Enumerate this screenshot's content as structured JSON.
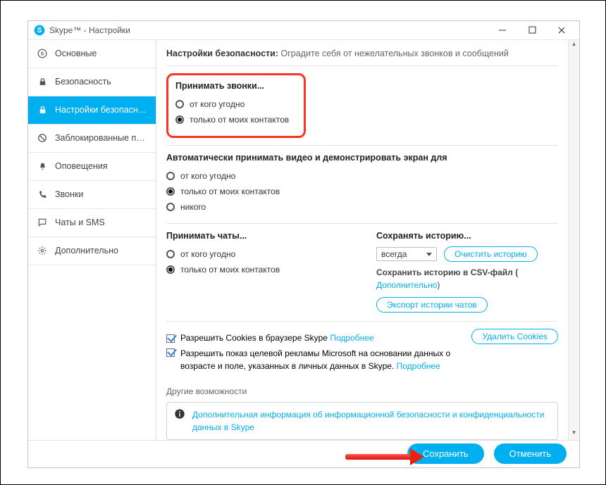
{
  "window": {
    "title": "Skype™ - Настройки"
  },
  "sidebar": {
    "items": [
      {
        "label": "Основные",
        "icon": "skype-icon"
      },
      {
        "label": "Безопасность",
        "icon": "lock-icon"
      },
      {
        "label": "Настройки безопасно...",
        "icon": "lock-icon"
      },
      {
        "label": "Заблокированные по...",
        "icon": "blocked-icon"
      },
      {
        "label": "Оповещения",
        "icon": "bell-icon"
      },
      {
        "label": "Звонки",
        "icon": "phone-icon"
      },
      {
        "label": "Чаты и SMS",
        "icon": "chat-icon"
      },
      {
        "label": "Дополнительно",
        "icon": "gear-icon"
      }
    ]
  },
  "header": {
    "bold": "Настройки безопасности:",
    "rest": "Оградите себя от нежелательных звонков и сообщений"
  },
  "calls": {
    "title": "Принимать звонки...",
    "opt_anyone": "от кого угодно",
    "opt_contacts": "только от моих контактов"
  },
  "video": {
    "title": "Автоматически принимать видео и демонстрировать экран для",
    "opt_anyone": "от кого угодно",
    "opt_contacts": "только от моих контактов",
    "opt_nobody": "никого"
  },
  "chats": {
    "title": "Принимать чаты...",
    "opt_anyone": "от кого угодно",
    "opt_contacts": "только от моих контактов"
  },
  "history": {
    "title": "Сохранять историю...",
    "select_value": "всегда",
    "clear_btn": "Очистить историю",
    "csv_line1": "Сохранить историю в CSV-файл (",
    "csv_link": "Дополнительно",
    "csv_close": ")",
    "export_btn": "Экспорт истории чатов"
  },
  "cookies": {
    "allow_label": "Разрешить Cookies в браузере Skype",
    "more": "Подробнее",
    "delete_btn": "Удалить Cookies"
  },
  "ads": {
    "label": "Разрешить показ целевой рекламы Microsoft на основании данных о возрасте и поле, указанных в личных данных в Skype.",
    "more": "Подробнее"
  },
  "other": {
    "title": "Другие возможности",
    "info": "Дополнительная информация об информационной безопасности и конфиденциальности данных в Skype"
  },
  "footer": {
    "save": "Сохранить",
    "cancel": "Отменить"
  }
}
